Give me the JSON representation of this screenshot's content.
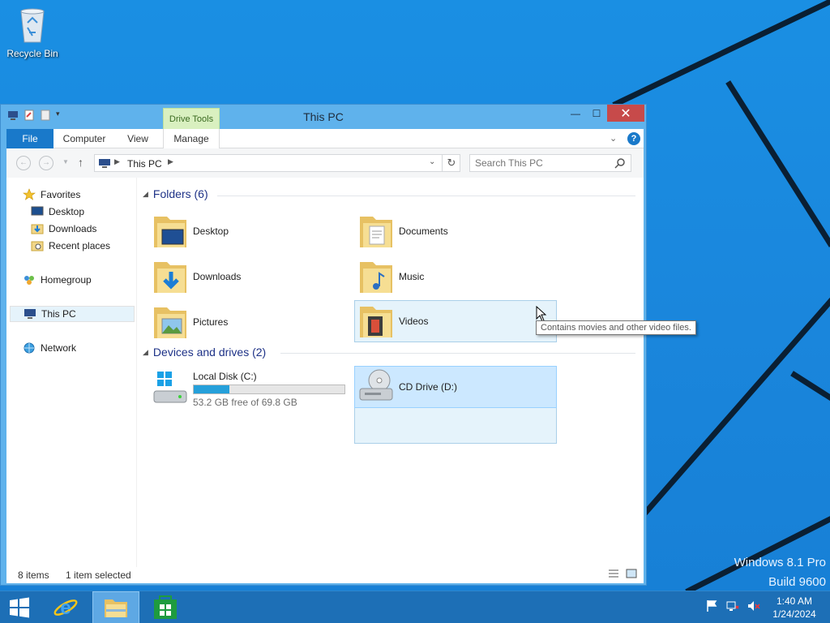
{
  "desktop": {
    "recycle_bin_label": "Recycle Bin",
    "watermark_line1": "Windows 8.1 Pro",
    "watermark_line2": "Build 9600"
  },
  "window": {
    "title": "This PC",
    "contextual_tab_label": "Drive Tools",
    "ribbon_tabs": {
      "file": "File",
      "computer": "Computer",
      "view": "View",
      "manage": "Manage"
    },
    "address_text": "This PC",
    "search_placeholder": "Search This PC"
  },
  "nav_pane": {
    "favorites": "Favorites",
    "desktop": "Desktop",
    "downloads": "Downloads",
    "recent": "Recent places",
    "homegroup": "Homegroup",
    "this_pc": "This PC",
    "network": "Network"
  },
  "folders_group": {
    "header": "Folders (6)",
    "items": [
      "Desktop",
      "Documents",
      "Downloads",
      "Music",
      "Pictures",
      "Videos"
    ]
  },
  "devices_group": {
    "header": "Devices and drives (2)",
    "local_disk": {
      "name": "Local Disk (C:)",
      "free_text": "53.2 GB free of 69.8 GB",
      "used_fraction": 0.238
    },
    "cd_drive": {
      "name": "CD Drive (D:)"
    }
  },
  "tooltip_text": "Contains movies and other video files.",
  "status": {
    "count": "8 items",
    "selected": "1 item selected"
  },
  "clock": {
    "time": "1:40 AM",
    "date": "1/24/2024"
  },
  "colors": {
    "desktop_bg": "#1a86dc",
    "window_frame": "#5fb2ec",
    "file_tab": "#1979ca",
    "close_button": "#c74a4a",
    "drive_bar_fill": "#26a0da",
    "taskbar": "#1d6fb6"
  }
}
